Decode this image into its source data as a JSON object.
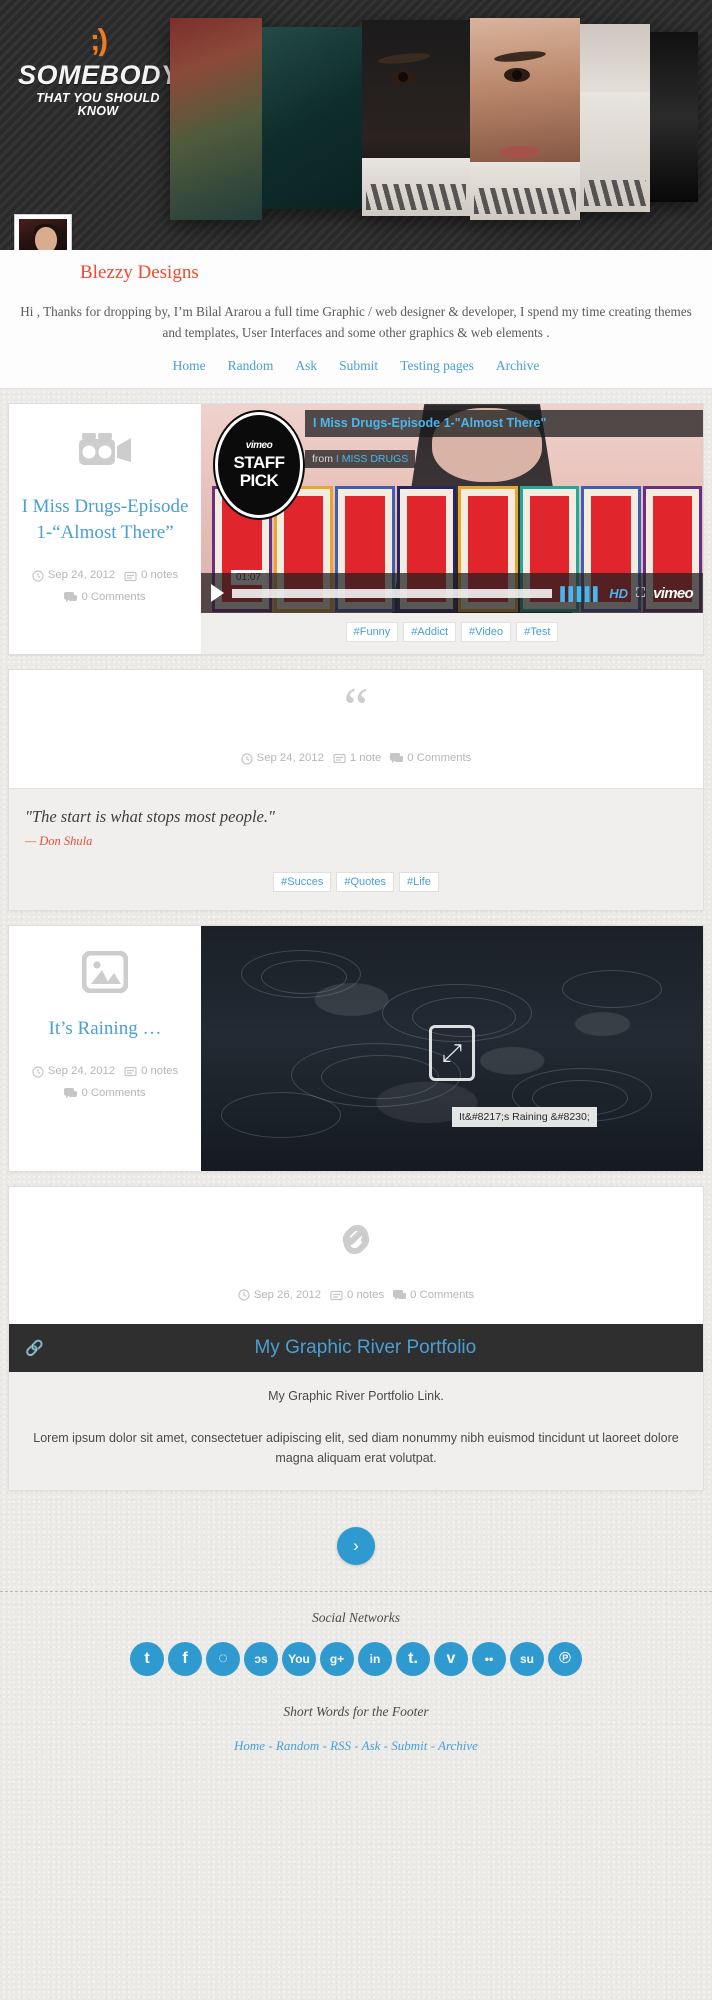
{
  "header": {
    "logo_wink": ";)",
    "logo_main": "SOMEBODY",
    "logo_sub": "THAT YOU SHOULD KNOW",
    "avatar_name": "avatar"
  },
  "intro": {
    "title": "Blezzy Designs",
    "text": "Hi , Thanks for dropping by, I’m Bilal Ararou a full time Graphic / web designer & developer, I spend my time creating themes and templates, User Interfaces and some other graphics & web elements .",
    "nav": [
      {
        "label": "Home"
      },
      {
        "label": "Random"
      },
      {
        "label": "Ask"
      },
      {
        "label": "Submit"
      },
      {
        "label": "Testing pages"
      },
      {
        "label": "Archive"
      }
    ]
  },
  "posts": {
    "video": {
      "icon": "video-camera-icon",
      "title": "I Miss Drugs-Episode 1-“Almost There”",
      "date": "Sep 24, 2012",
      "notes": "0 notes",
      "comments": "0 Comments",
      "player": {
        "badge_brand": "vimeo",
        "badge_line1": "STAFF",
        "badge_line2": "PICK",
        "title": "I Miss Drugs-Episode 1-\"Almost There\"",
        "from_label": "from",
        "from_source": "I MISS DRUGS",
        "timecode": "01:07",
        "hd_label": "HD",
        "watermark": "vimeo"
      },
      "tags": [
        "#Funny",
        "#Addict",
        "#Video",
        "#Test"
      ]
    },
    "quote": {
      "icon": "quote-mark-icon",
      "mark": "“",
      "date": "Sep 24, 2012",
      "notes": "1 note",
      "comments": "0 Comments",
      "text": "\"The start is what stops most people.\"",
      "source": "— Don Shula",
      "tags": [
        "#Succes",
        "#Quotes",
        "#Life"
      ]
    },
    "photo": {
      "icon": "image-icon",
      "title": "It’s Raining …",
      "date": "Sep 24, 2012",
      "notes": "0 notes",
      "comments": "0 Comments",
      "caption": "It&#8217;s Raining &#8230;"
    },
    "link": {
      "icon": "chain-link-icon",
      "date": "Sep 26, 2012",
      "notes": "0 notes",
      "comments": "0 Comments",
      "link_label": "My Graphic River Portfolio",
      "description": "My Graphic River Portfolio Link.",
      "lorem": "Lorem ipsum dolor sit amet, consectetuer adipiscing elit, sed diam nonummy nibh euismod tincidunt ut laoreet dolore magna aliquam erat volutpat."
    }
  },
  "pager": {
    "next_glyph": "›"
  },
  "footer": {
    "social_heading": "Social Networks",
    "socials": [
      {
        "name": "twitter-icon",
        "glyph": "t"
      },
      {
        "name": "facebook-icon",
        "glyph": "f"
      },
      {
        "name": "dribbble-icon",
        "glyph": "◌"
      },
      {
        "name": "lastfm-icon",
        "glyph": "ɔs"
      },
      {
        "name": "youtube-icon",
        "glyph": "You"
      },
      {
        "name": "googleplus-icon",
        "glyph": "g+"
      },
      {
        "name": "linkedin-icon",
        "glyph": "in"
      },
      {
        "name": "tumblr-icon",
        "glyph": "t."
      },
      {
        "name": "vimeo-icon",
        "glyph": "v"
      },
      {
        "name": "flickr-icon",
        "glyph": "••"
      },
      {
        "name": "stumbleupon-icon",
        "glyph": "su"
      },
      {
        "name": "pinterest-icon",
        "glyph": "℗"
      }
    ],
    "short_words": "Short Words for the Footer",
    "nav": [
      {
        "label": "Home"
      },
      {
        "label": "Random"
      },
      {
        "label": "RSS"
      },
      {
        "label": "Ask"
      },
      {
        "label": "Submit"
      },
      {
        "label": "Archive"
      }
    ],
    "nav_sep": " - "
  },
  "colors": {
    "accent_blue": "#4a9fd4",
    "accent_orange": "#f2492a",
    "social_blue": "#2f9ad0",
    "dark": "#2f2f2f"
  }
}
